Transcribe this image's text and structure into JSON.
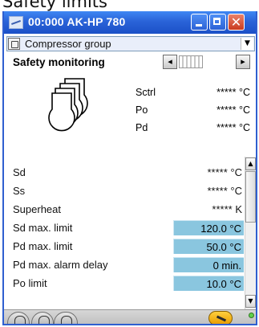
{
  "page_title": "Safety limits",
  "window": {
    "title": "00:000 AK-HP 780",
    "icons": {
      "app": "sensor-icon",
      "minimize": "minimize-icon",
      "maximize": "maximize-icon",
      "close": "close-icon"
    }
  },
  "group": {
    "label": "Compressor group",
    "icon": "group-icon",
    "dropdown_icon": "chevron-down-icon"
  },
  "section": {
    "title": "Safety monitoring",
    "prev": "◂",
    "next": "▸"
  },
  "sensors": [
    {
      "label": "Sctrl",
      "value": "***** °C"
    },
    {
      "label": "Po",
      "value": "***** °C"
    },
    {
      "label": "Pd",
      "value": "***** °C"
    }
  ],
  "rows": [
    {
      "label": "Sd",
      "value": "***** °C",
      "editable": false
    },
    {
      "label": "Ss",
      "value": "***** °C",
      "editable": false
    },
    {
      "label": "Superheat",
      "value": "***** K",
      "editable": false
    },
    {
      "label": "Sd max. limit",
      "value": "120.0 °C",
      "editable": true
    },
    {
      "label": "Pd max. limit",
      "value": "50.0 °C",
      "editable": true
    },
    {
      "label": "Pd max. alarm delay",
      "value": "0 min.",
      "editable": true
    },
    {
      "label": "Po limit",
      "value": "10.0 °C",
      "editable": true
    }
  ],
  "colors": {
    "titlebar": "#2a63d8",
    "editable_cell": "#8ac6df",
    "status_led": "#5fd14a",
    "wrench": "#f0b000"
  },
  "bottom_tabs": [
    "compressor-group-tab-icon",
    "compressor-stack-tab-icon",
    "compressor-single-tab-icon"
  ],
  "bottom_actions": {
    "wrench": "wrench-icon",
    "status": "status-led-icon"
  }
}
